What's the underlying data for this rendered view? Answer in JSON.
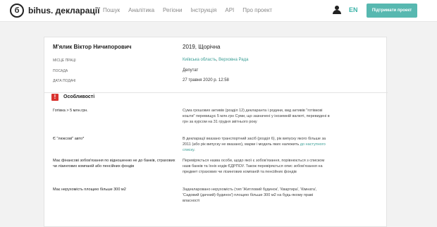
{
  "header": {
    "logo_letter": "б",
    "brand": "bihus. декларації",
    "nav": [
      "Пошук",
      "Аналітика",
      "Регіони",
      "Інструкція",
      "API",
      "Про проект"
    ],
    "lang": "EN",
    "support_button": "Підтримати проект"
  },
  "declaration": {
    "name": "М'ялик Віктор Ничипорович",
    "year_type": "2019, Щорічна",
    "fields": {
      "workplace_label": "МІСЦЕ ПРАЦІ",
      "workplace_region": "Київська область",
      "workplace_sep": ", ",
      "workplace_org": "Верховна Рада",
      "position_label": "ПОСАДА",
      "position_value": "Депутат",
      "date_label": "ДАТА ПОДАЧІ",
      "date_value": "27 травня 2020 р. 12:58"
    }
  },
  "features": {
    "icon": "!",
    "title": "Особливості",
    "rows": [
      {
        "label": "Готівка > 5 млн.грн.",
        "description": "Сума грошових активів (розділ 12) декларанта і родини, вид активів \"готівкові кошти\" перевищує 5 млн.грн Суми, що зазначені у іноземній валюті, перевидені в грн за курсом на 31 грудня звітнього року"
      },
      {
        "label": "Є \"люксові\" авто*",
        "description": "В декларації вказано транспортний засіб (розділ 6), рік випуску якого більше за 2011 (або рік випуску не вказано), марки і модель яких належить ",
        "link": "до наступного списку",
        "description_end": "."
      },
      {
        "label": "Має фінансові зобов'язання по відношенню не до банків, страхових чи лізингових компаній або пенсійних фондів",
        "description": "Перевіряється назва особи, щодо якої є зобов'язання, порівнюється з списком назв банків та їхніх кодів ЄДРПОУ. Також перевіряється опис зобов'язання на предмет страхових чи лізингових компаній та пенсійних фондів"
      },
      {
        "label": "Має нерухомість площею більше 300 м2",
        "description": "Задекларовано нерухомість (тип 'Житловий будинок', 'Квартира', 'Кімната', 'Садовий (дачний) будинок') площею більше 300 м2 на будь-якому праві власності"
      }
    ]
  }
}
